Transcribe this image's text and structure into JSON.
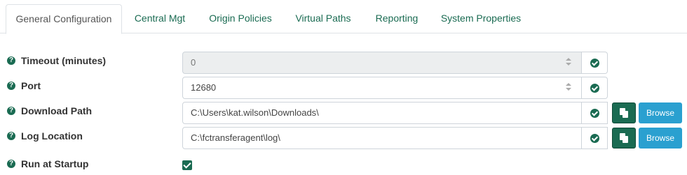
{
  "tabs": [
    {
      "label": "General Configuration",
      "active": true
    },
    {
      "label": "Central Mgt",
      "active": false
    },
    {
      "label": "Origin Policies",
      "active": false
    },
    {
      "label": "Virtual Paths",
      "active": false
    },
    {
      "label": "Reporting",
      "active": false
    },
    {
      "label": "System Properties",
      "active": false
    }
  ],
  "fields": {
    "timeout": {
      "label": "Timeout (minutes)",
      "value": "0"
    },
    "port": {
      "label": "Port",
      "value": "12680"
    },
    "download_path": {
      "label": "Download Path",
      "value": "C:\\Users\\kat.wilson\\Downloads\\",
      "browse": "Browse"
    },
    "log_location": {
      "label": "Log Location",
      "value": "C:\\fctransferagent\\log\\",
      "browse": "Browse"
    },
    "run_at_startup": {
      "label": "Run at Startup",
      "checked": true
    }
  },
  "help_glyph": "?",
  "colors": {
    "accent": "#1a6b52",
    "browse": "#2aa0d0",
    "tab_text": "#1a6b52"
  }
}
